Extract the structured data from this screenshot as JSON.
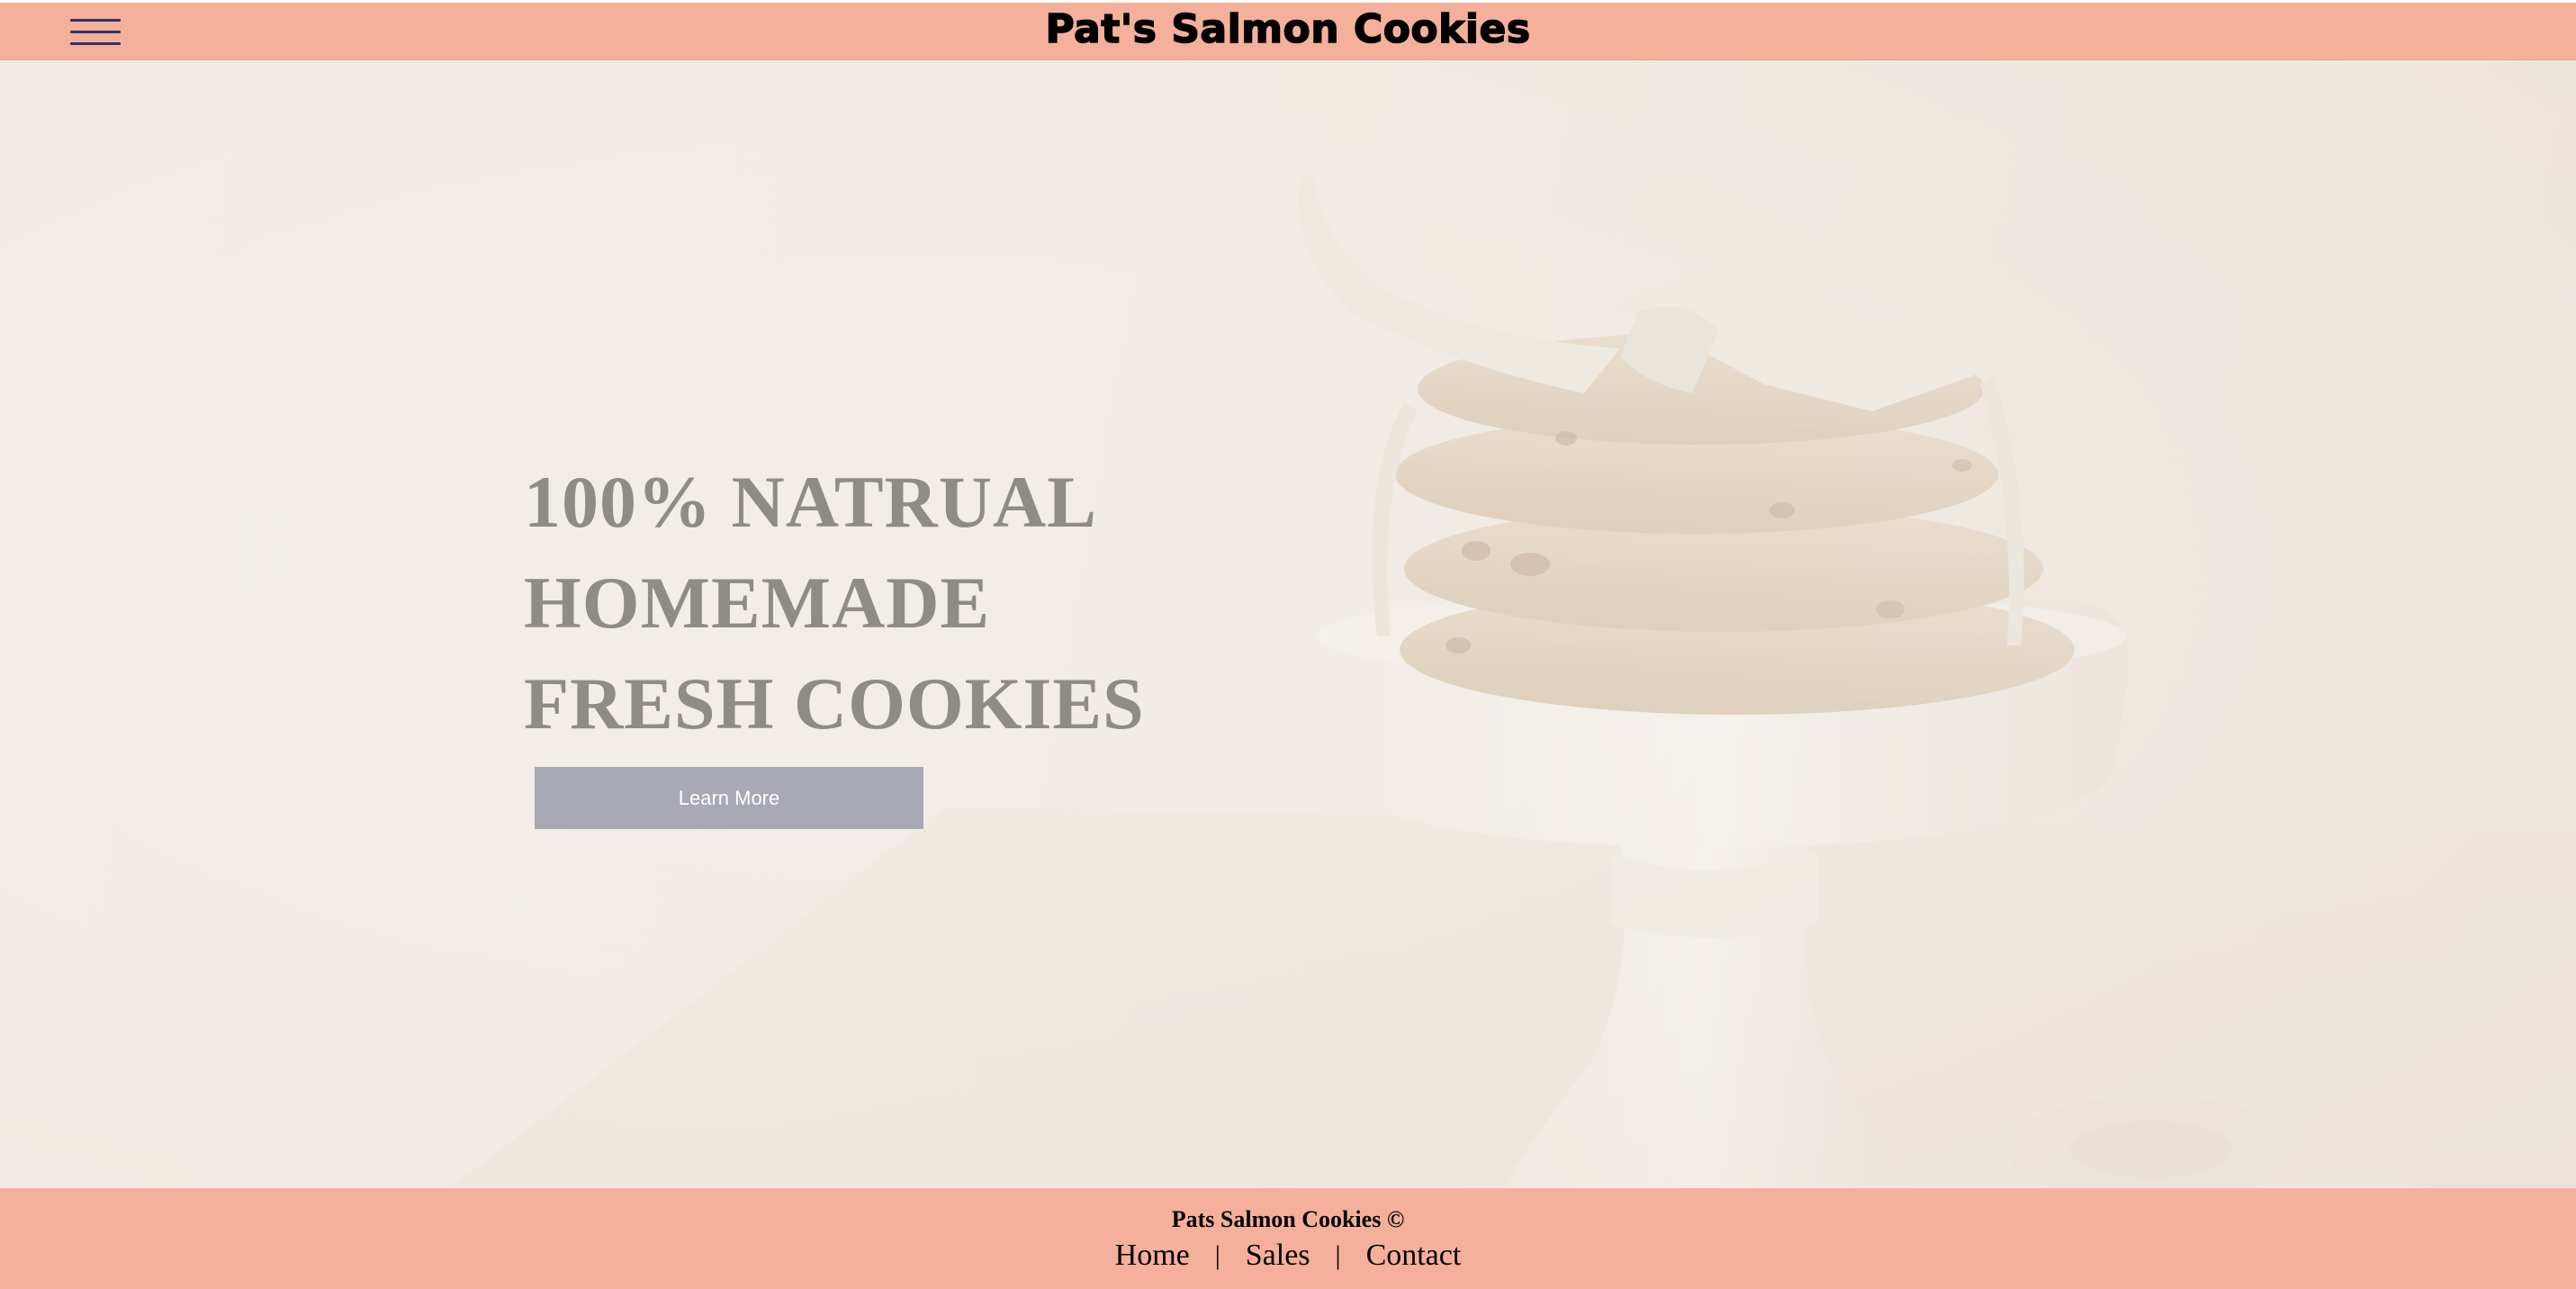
{
  "header": {
    "title": "Pat's Salmon Cookies",
    "menu_icon": "hamburger-menu-icon"
  },
  "hero": {
    "headline_lines": [
      "100% NATRUAL",
      "HOMEMADE",
      "FRESH COOKIES"
    ],
    "cta_label": "Learn More",
    "image": "stack-of-cookies-on-cake-stand"
  },
  "footer": {
    "copyright": "Pats Salmon Cookies ©",
    "nav": [
      "Home",
      "Sales",
      "Contact"
    ],
    "separator": "|"
  },
  "colors": {
    "header_bg": "#f5b09c",
    "footer_bg": "#f5b09c",
    "menu_icon": "#2f3466",
    "headline": "#8f8b86",
    "button_bg": "#a8a9b4",
    "button_text": "#ffffff"
  }
}
